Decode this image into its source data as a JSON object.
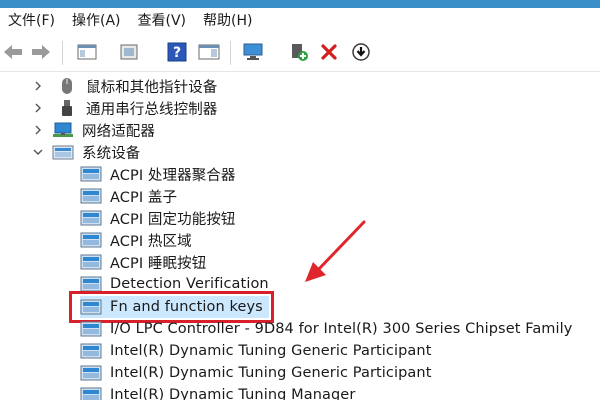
{
  "menu": [
    {
      "name": "menu-file",
      "label": "文件(F)"
    },
    {
      "name": "menu-action",
      "label": "操作(A)"
    },
    {
      "name": "menu-view",
      "label": "查看(V)"
    },
    {
      "name": "menu-help",
      "label": "帮助(H)"
    }
  ],
  "toolbar": [
    {
      "name": "back-arrow-icon"
    },
    {
      "name": "forward-arrow-icon"
    },
    {
      "name": "show-hide-console-tree-icon"
    },
    {
      "name": "properties-icon"
    },
    {
      "name": "help-icon"
    },
    {
      "name": "action-pane-icon"
    },
    {
      "name": "scan-hardware-changes-icon"
    },
    {
      "name": "update-driver-icon"
    },
    {
      "name": "uninstall-device-icon"
    },
    {
      "name": "disable-device-icon"
    }
  ],
  "tree": {
    "categories": [
      {
        "label": "鼠标和其他指针设备",
        "expanded": false,
        "icon": "mouse-icon"
      },
      {
        "label": "通用串行总线控制器",
        "expanded": false,
        "icon": "usb-icon"
      },
      {
        "label": "网络适配器",
        "expanded": false,
        "icon": "network-adapter-icon"
      },
      {
        "label": "系统设备",
        "expanded": true,
        "icon": "system-devices-icon"
      }
    ],
    "system_devices": [
      "ACPI 处理器聚合器",
      "ACPI 盖子",
      "ACPI 固定功能按钮",
      "ACPI 热区域",
      "ACPI 睡眠按钮",
      "Detection Verification",
      "Fn and function keys",
      "I/O LPC Controller - 9D84 for Intel(R) 300 Series Chipset Family",
      "Intel(R) Dynamic Tuning Generic Participant",
      "Intel(R) Dynamic Tuning Generic Participant",
      "Intel(R) Dynamic Tuning Manager"
    ]
  },
  "colors": {
    "highlight_box": "#d8202a",
    "selection_bg": "#cce8ff",
    "accent": "#3a8fc9",
    "annotation_arrow": "#e0262d"
  }
}
